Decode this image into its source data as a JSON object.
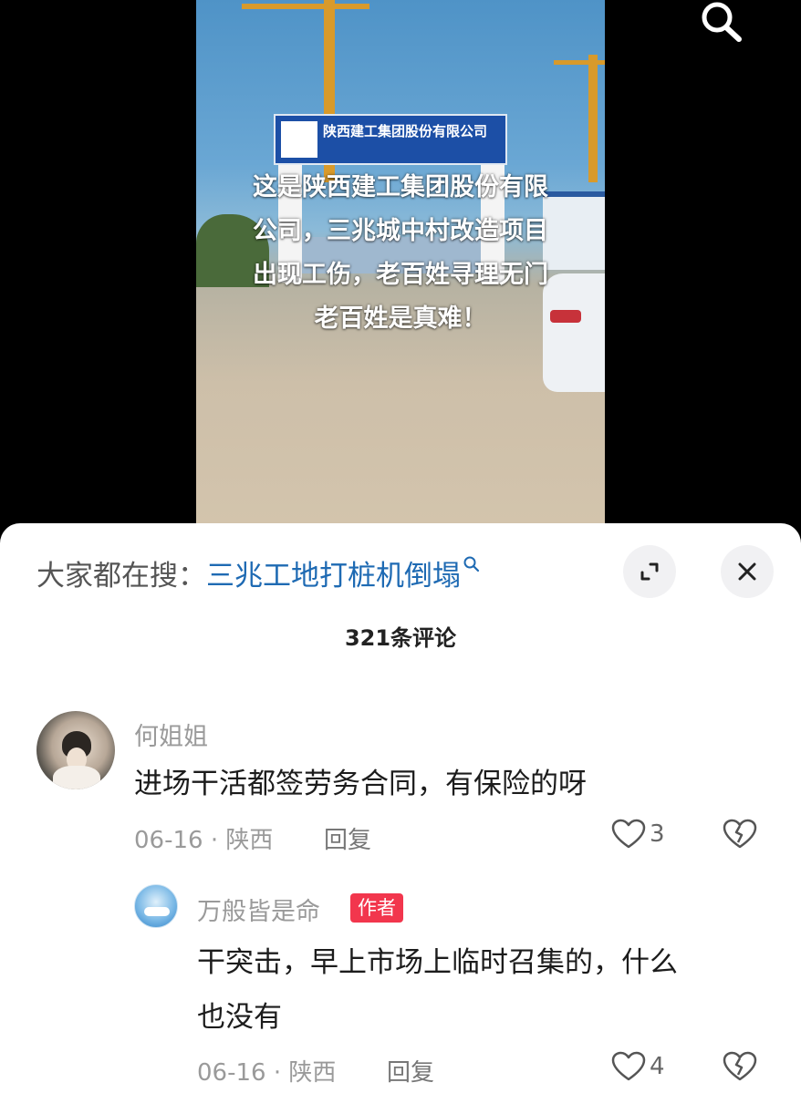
{
  "video": {
    "overlay_text": "这是陕西建工集团股份有限\n公司，三兆城中村改造项目\n出现工伤，老百姓寻理无门\n老百姓是真难！",
    "sign_title": "陕西建工集团股份有限公司",
    "search_icon": "search-icon"
  },
  "sheet": {
    "suggest_prefix": "大家都在搜：",
    "suggest_query": "三兆工地打桩机倒塌",
    "comment_count": "321条评论",
    "expand_icon": "expand-icon",
    "close_icon": "close-icon"
  },
  "comments": [
    {
      "username": "何姐姐",
      "text": "进场干活都签劳务合同，有保险的呀",
      "meta": "06-16 · 陕西",
      "reply_label": "回复",
      "likes": "3"
    },
    {
      "username": "万般皆是命",
      "badge": "作者",
      "text": "干突击，早上市场上临时召集的，什么\n也没有",
      "meta": "06-16 · 陕西",
      "reply_label": "回复",
      "likes": "4"
    }
  ],
  "colors": {
    "link": "#1e6ab3",
    "badge": "#f2364d",
    "muted": "#9a9a9a"
  }
}
